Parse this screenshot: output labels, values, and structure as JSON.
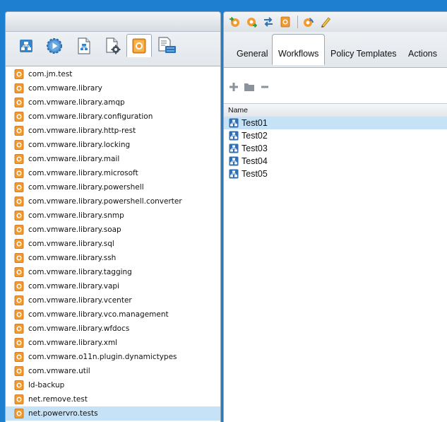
{
  "colors": {
    "background": "#1e7fd0",
    "selection": "#c5e2f7",
    "package_icon": "#f29a2e",
    "workflow_icon": "#2f6fb3"
  },
  "left_panel": {
    "tabs": [
      {
        "icon": "workflow-icon",
        "active": false
      },
      {
        "icon": "actions-icon",
        "active": false
      },
      {
        "icon": "policy-templates-icon",
        "active": false
      },
      {
        "icon": "configurations-icon",
        "active": false
      },
      {
        "icon": "packages-icon",
        "active": true
      },
      {
        "icon": "inventory-icon",
        "active": false
      }
    ],
    "packages": [
      {
        "label": "com.jm.test",
        "selected": false
      },
      {
        "label": "com.vmware.library",
        "selected": false
      },
      {
        "label": "com.vmware.library.amqp",
        "selected": false
      },
      {
        "label": "com.vmware.library.configuration",
        "selected": false
      },
      {
        "label": "com.vmware.library.http-rest",
        "selected": false
      },
      {
        "label": "com.vmware.library.locking",
        "selected": false
      },
      {
        "label": "com.vmware.library.mail",
        "selected": false
      },
      {
        "label": "com.vmware.library.microsoft",
        "selected": false
      },
      {
        "label": "com.vmware.library.powershell",
        "selected": false
      },
      {
        "label": "com.vmware.library.powershell.converter",
        "selected": false
      },
      {
        "label": "com.vmware.library.snmp",
        "selected": false
      },
      {
        "label": "com.vmware.library.soap",
        "selected": false
      },
      {
        "label": "com.vmware.library.sql",
        "selected": false
      },
      {
        "label": "com.vmware.library.ssh",
        "selected": false
      },
      {
        "label": "com.vmware.library.tagging",
        "selected": false
      },
      {
        "label": "com.vmware.library.vapi",
        "selected": false
      },
      {
        "label": "com.vmware.library.vcenter",
        "selected": false
      },
      {
        "label": "com.vmware.library.vco.management",
        "selected": false
      },
      {
        "label": "com.vmware.library.wfdocs",
        "selected": false
      },
      {
        "label": "com.vmware.library.xml",
        "selected": false
      },
      {
        "label": "com.vmware.o11n.plugin.dynamictypes",
        "selected": false
      },
      {
        "label": "com.vmware.util",
        "selected": false
      },
      {
        "label": "ld-backup",
        "selected": false
      },
      {
        "label": "net.remove.test",
        "selected": false
      },
      {
        "label": "net.powervro.tests",
        "selected": true
      }
    ]
  },
  "right_panel": {
    "toolbar": [
      {
        "icon": "import-package-icon"
      },
      {
        "icon": "export-package-icon"
      },
      {
        "icon": "synchronize-icon"
      },
      {
        "icon": "package-icon"
      },
      {
        "icon": "refresh-package-icon"
      },
      {
        "icon": "edit-pencil-icon"
      }
    ],
    "tabs": {
      "general": "General",
      "workflows": "Workflows",
      "policy_templates": "Policy Templates",
      "actions": "Actions",
      "active": "workflows"
    },
    "edit_toolbar": [
      {
        "icon": "add-icon"
      },
      {
        "icon": "add-folder-icon"
      },
      {
        "icon": "remove-icon"
      }
    ],
    "workflow_table": {
      "column_name": "Name",
      "rows": [
        {
          "label": "Test01",
          "selected": true
        },
        {
          "label": "Test02",
          "selected": false
        },
        {
          "label": "Test03",
          "selected": false
        },
        {
          "label": "Test04",
          "selected": false
        },
        {
          "label": "Test05",
          "selected": false
        }
      ]
    }
  }
}
